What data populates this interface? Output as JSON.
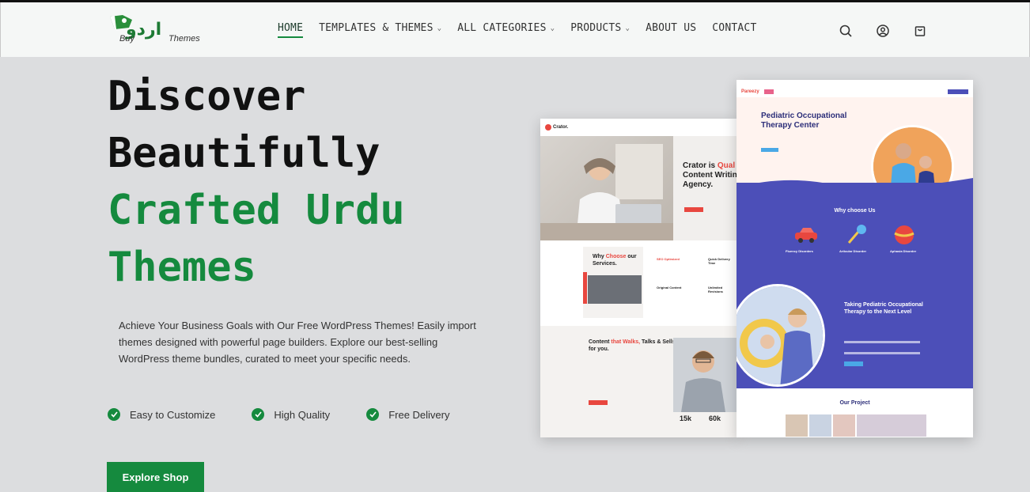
{
  "header": {
    "logo_urdu": "اردو",
    "logo_buy": "Buy",
    "logo_themes": "Themes",
    "nav": [
      {
        "label": "HOME",
        "active": true,
        "dropdown": false
      },
      {
        "label": "TEMPLATES & THEMES",
        "active": false,
        "dropdown": true
      },
      {
        "label": "ALL CATEGORIES",
        "active": false,
        "dropdown": true
      },
      {
        "label": "PRODUCTS",
        "active": false,
        "dropdown": true
      },
      {
        "label": "ABOUT US",
        "active": false,
        "dropdown": false
      },
      {
        "label": "CONTACT",
        "active": false,
        "dropdown": false
      }
    ],
    "icons": [
      "search-icon",
      "user-icon",
      "cart-icon"
    ]
  },
  "hero": {
    "line1": "Discover",
    "line2": "Beautifully",
    "line3": "Crafted Urdu",
    "line4": "Themes",
    "description": "Achieve Your Business Goals with Our Free WordPress Themes! Easily import themes designed with powerful page builders. Explore our best-selling WordPress theme bundles, curated to meet your specific needs.",
    "features": [
      "Easy to Customize",
      "High Quality",
      "Free Delivery"
    ],
    "cta": "Explore Shop"
  },
  "mockup_crator": {
    "logo": "Crator.",
    "hero_title_a": "Crator is ",
    "hero_title_accent": "Qual",
    "hero_title_b": "Content Writin",
    "hero_title_c": "Agency.",
    "why_a": "Why ",
    "why_accent": "Choose",
    "why_b": " our Services.",
    "features": [
      "SEO Optimized",
      "Quick Delivery Time",
      "Original Content",
      "Unlimited Revisions"
    ],
    "content_a": "Content ",
    "content_accent": "that Walks,",
    "content_b": " Talks & Sells for you.",
    "stat1": "15k",
    "stat2": "60k"
  },
  "mockup_pareezy": {
    "logo": "Pareezy",
    "title": "Pediatric Occupational Therapy Center",
    "why": "Why choose Us",
    "services": [
      "Fluency Disorders",
      "Articular Disorder",
      "Aphasia Disorder"
    ],
    "section_title": "Taking Pediatric Occupational Therapy to the Next Level",
    "project": "Our Project"
  },
  "colors": {
    "brand_green": "#158a3e",
    "accent_red": "#e8473f",
    "indigo": "#4c4fb8"
  }
}
